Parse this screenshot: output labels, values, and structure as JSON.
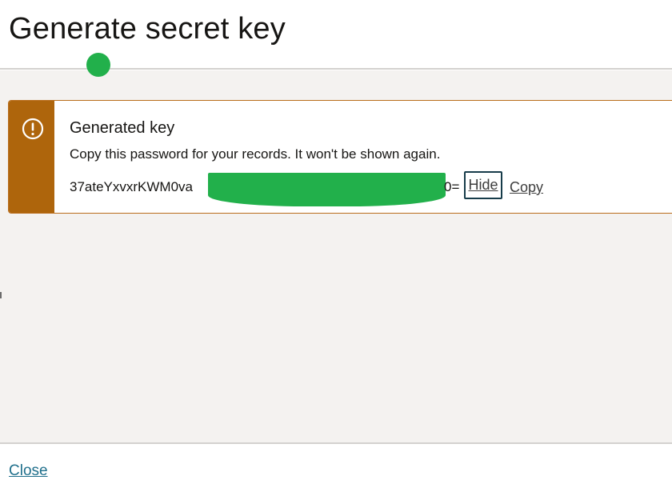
{
  "dialog": {
    "title": "Generate secret key"
  },
  "banner": {
    "icon": "warning-icon",
    "title": "Generated key",
    "message": "Copy this password for your records. It won't be shown again.",
    "key_visible_start": "37ateYxvxrKWM0va",
    "key_visible_end": "0=",
    "hide_label": "Hide",
    "copy_label": "Copy",
    "colors": {
      "stripe": "#ae650c",
      "border": "#b96d1b"
    }
  },
  "footer": {
    "close_label": "Close"
  },
  "annotations": {
    "redaction_color": "#22b04b",
    "marker_color": "#22b04b"
  }
}
